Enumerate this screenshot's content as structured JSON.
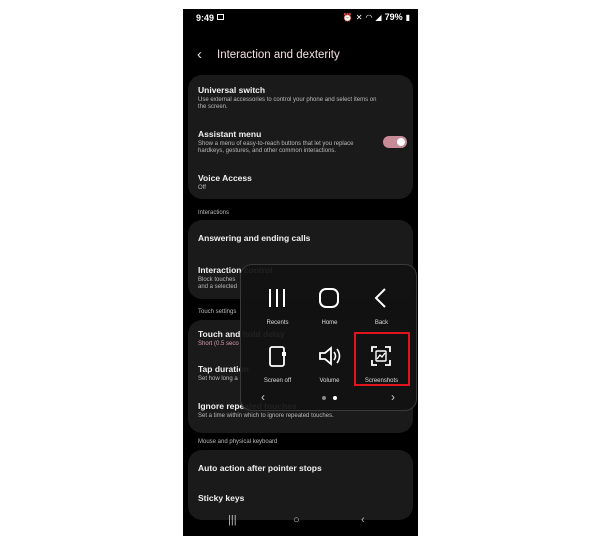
{
  "status_bar": {
    "time": "9:49",
    "battery": "79%"
  },
  "header": {
    "back_icon": "chevron-left-icon",
    "title": "Interaction and dexterity"
  },
  "settings": {
    "universal_switch": {
      "title": "Universal switch",
      "subtitle": "Use external accessories to control your phone and select items on the screen."
    },
    "assistant_menu": {
      "title": "Assistant menu",
      "subtitle": "Show a menu of easy-to-reach buttons that let you replace hardkeys, gestures, and other common interactions.",
      "enabled": true
    },
    "voice_access": {
      "title": "Voice Access",
      "subtitle": "Off"
    },
    "section_interactions": "Interactions",
    "answering_calls": {
      "title": "Answering and ending calls"
    },
    "interaction_control": {
      "title": "Interaction control",
      "subtitle_line1": "Block touches",
      "subtitle_line2": "and a selected"
    },
    "section_touch": "Touch settings",
    "touch_hold": {
      "title": "Touch and hold delay",
      "subtitle": "Short (0.5 seco"
    },
    "tap_duration": {
      "title": "Tap duration",
      "subtitle": "Set how long a"
    },
    "ignore_repeated": {
      "title": "Ignore repeated touches",
      "subtitle": "Set a time within which to ignore repeated touches."
    },
    "section_mouse": "Mouse and physical keyboard",
    "auto_action": {
      "title": "Auto action after pointer stops"
    },
    "sticky_keys": {
      "title": "Sticky keys"
    }
  },
  "assistant_overlay": {
    "buttons": [
      {
        "label": "Recents",
        "icon": "recents-icon"
      },
      {
        "label": "Home",
        "icon": "home-icon"
      },
      {
        "label": "Back",
        "icon": "back-icon"
      },
      {
        "label": "Screen off",
        "icon": "screen-off-icon"
      },
      {
        "label": "Volume",
        "icon": "volume-icon"
      },
      {
        "label": "Screenshots",
        "icon": "screenshot-icon"
      }
    ],
    "highlight_color": "#e0141b"
  },
  "colors": {
    "accent": "#c98a98",
    "card": "#1a1a1a",
    "background": "#000000"
  }
}
